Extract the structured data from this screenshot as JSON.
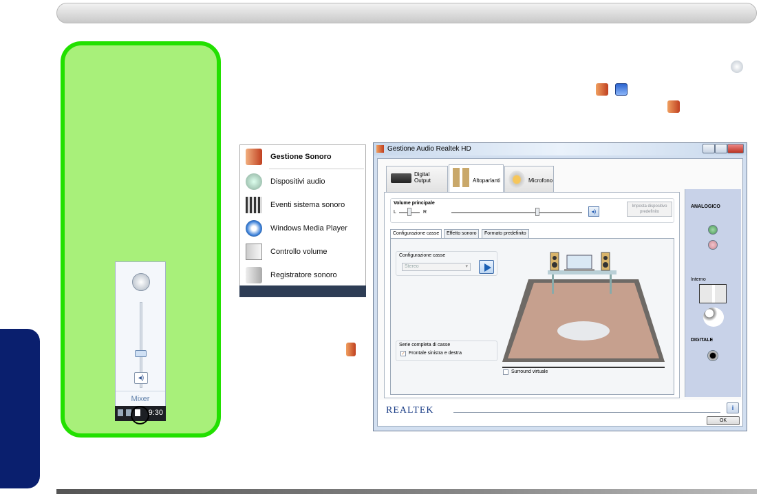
{
  "start_menu": {
    "items": [
      {
        "label": "Gestione Sonoro",
        "icon": "speaker-icon",
        "bold": true
      },
      {
        "label": "Dispositivi audio",
        "icon": "audio-devices-icon"
      },
      {
        "label": "Eventi sistema sonoro",
        "icon": "sound-events-icon"
      },
      {
        "label": "Windows Media Player",
        "icon": "media-player-icon"
      },
      {
        "label": "Controllo volume",
        "icon": "volume-control-icon"
      },
      {
        "label": "Registratore sonoro",
        "icon": "sound-recorder-icon"
      }
    ]
  },
  "volume_popup": {
    "mixer_label": "Mixer",
    "tray_time": "9:30"
  },
  "realtek": {
    "window_title": "Gestione Audio Realtek HD",
    "tabs": [
      "Digital Output",
      "Altoparlanti",
      "Microfono"
    ],
    "volume_group_label": "Volume principale",
    "balance_left": "L",
    "balance_right": "R",
    "default_device_button": "Imposta dispositivo predefinito",
    "sub_tabs": [
      "Configurazione casse",
      "Effetto sonoro",
      "Formato predefinito"
    ],
    "config_group_label": "Configurazione casse",
    "config_select_value": "Stereo",
    "full_range_label": "Serie completa di casse",
    "front_lr_label": "Frontale sinistra e destra",
    "surround_label": "Surround virtuale",
    "right_panel": {
      "analog": "ANALOGICO",
      "internal": "Interno",
      "digital": "DIGITALE"
    },
    "logo_text": "REALTEK",
    "ok_label": "OK",
    "info_label": "i"
  },
  "colors": {
    "note_border": "#22e000",
    "note_fill": "#a8f07a",
    "side_tab": "#0a1f6e"
  }
}
